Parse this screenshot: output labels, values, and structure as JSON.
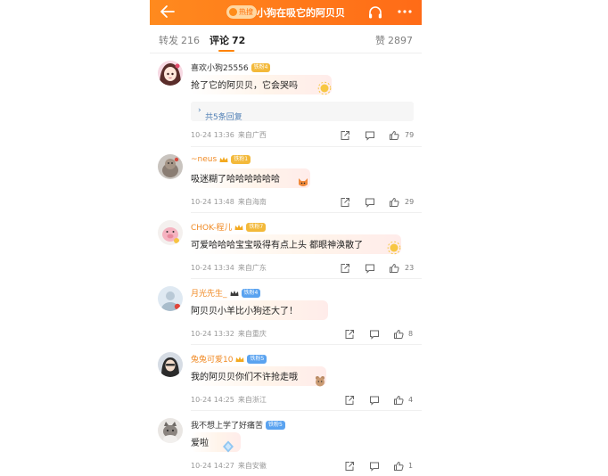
{
  "header": {
    "hot_badge": "热搜",
    "title": "小狗在吸它的阿贝贝"
  },
  "tabs": {
    "repost_label": "转发",
    "repost_count": "216",
    "comments_label": "评论",
    "comments_count": "72",
    "likes_label": "赞",
    "likes_count": "2897"
  },
  "colors": {
    "accent": "#ff8200",
    "link": "#4f7fb5",
    "username_highlight": "#f08a24"
  },
  "comments": [
    {
      "username": "喜欢小狗25556",
      "badge": "铁粉4",
      "text": "抢了它的阿贝贝，它会哭吗",
      "replies_link": "共5条回复",
      "time": "10-24 13:36",
      "location": "来自广西",
      "likes": "79"
    },
    {
      "username": "~neus",
      "badge": "铁粉1",
      "text": "吸迷糊了哈哈哈哈哈哈",
      "time": "10-24 13:48",
      "location": "来自海南",
      "likes": "29"
    },
    {
      "username": "CHOK-程儿",
      "badge": "铁粉7",
      "text": "可爱哈哈哈宝宝吸得有点上头 都眼神涣散了",
      "time": "10-24 13:34",
      "location": "来自广东",
      "likes": "23"
    },
    {
      "username": "月光先生_",
      "badge": "铁粉4",
      "text": "阿贝贝小羊比小狗还大了！",
      "time": "10-24 13:32",
      "location": "来自重庆",
      "likes": "8"
    },
    {
      "username": "兔兔可爱10",
      "badge": "铁粉5",
      "text": "我的阿贝贝你们不许抢走哦",
      "time": "10-24 14:25",
      "location": "来自浙江",
      "likes": "4"
    },
    {
      "username": "我不想上学了好痛苦",
      "badge": "铁粉5",
      "text": "爱啦",
      "time": "10-24 14:27",
      "location": "来自安徽",
      "likes": "1"
    }
  ]
}
